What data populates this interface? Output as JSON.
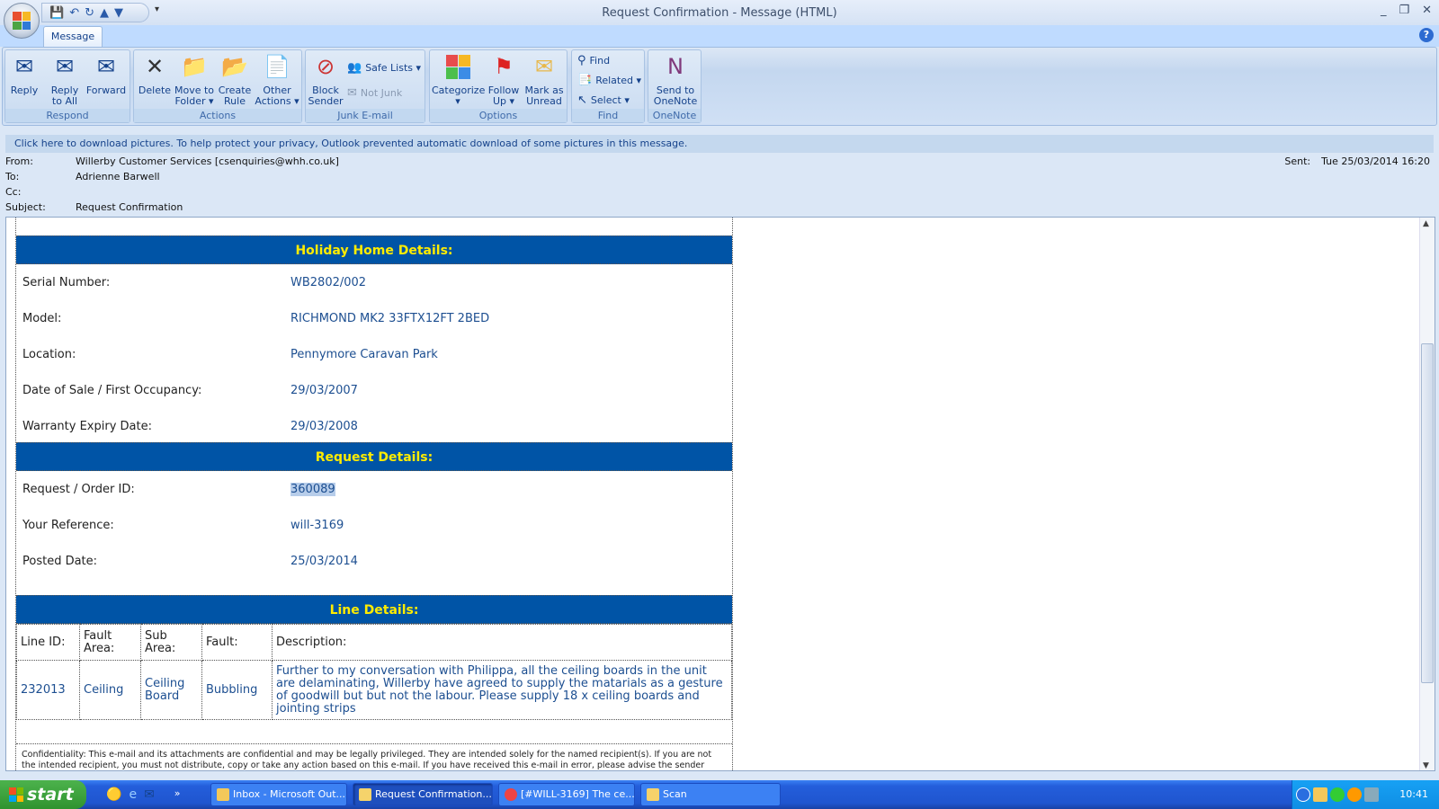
{
  "window": {
    "title": "Request Confirmation - Message (HTML)",
    "controls": [
      "_",
      "❐",
      "✕"
    ]
  },
  "quick_access": {
    "icons": [
      "save-icon",
      "undo-icon",
      "redo-icon",
      "previous-icon",
      "next-icon"
    ],
    "more": "▾"
  },
  "tabs": [
    {
      "label": "Message",
      "active": true
    }
  ],
  "ribbon": {
    "groups": [
      {
        "label": "Respond",
        "buttons": [
          "Reply",
          "Reply\nto All",
          "Forward"
        ]
      },
      {
        "label": "Actions",
        "buttons": [
          "Delete",
          "Move to\nFolder ▾",
          "Create\nRule",
          "Other\nActions ▾"
        ]
      },
      {
        "label": "Junk E-mail",
        "buttons": [
          "Block\nSender"
        ],
        "small": [
          "Safe Lists ▾",
          "Not Junk"
        ]
      },
      {
        "label": "Options",
        "buttons": [
          "Categorize\n▾",
          "Follow\nUp ▾",
          "Mark as\nUnread"
        ]
      },
      {
        "label": "Find",
        "small": [
          "Find",
          "Related ▾",
          "Select ▾"
        ]
      },
      {
        "label": "OneNote",
        "buttons": [
          "Send to\nOneNote"
        ]
      }
    ]
  },
  "infobar": "Click here to download pictures. To help protect your privacy, Outlook prevented automatic download of some pictures in this message.",
  "header": {
    "from_label": "From:",
    "from": "Willerby Customer Services [csenquiries@whh.co.uk]",
    "to_label": "To:",
    "to": "Adrienne Barwell",
    "cc_label": "Cc:",
    "cc": "",
    "subject_label": "Subject:",
    "subject": "Request Confirmation",
    "sent_label": "Sent:",
    "sent": "Tue 25/03/2014 16:20"
  },
  "email": {
    "holiday_title": "Holiday Home Details:",
    "holiday": [
      {
        "label": "Serial Number:",
        "value": "WB2802/002"
      },
      {
        "label": "Model:",
        "value": "RICHMOND MK2 33FTX12FT 2BED"
      },
      {
        "label": "Location:",
        "value": "Pennymore Caravan Park"
      },
      {
        "label": "Date of Sale / First Occupancy:",
        "value": "29/03/2007"
      },
      {
        "label": "Warranty Expiry Date:",
        "value": "29/03/2008"
      }
    ],
    "request_title": "Request Details:",
    "request": [
      {
        "label": "Request / Order ID:",
        "value": "360089",
        "selected": true
      },
      {
        "label": "Your Reference:",
        "value": "will-3169"
      },
      {
        "label": "Posted Date:",
        "value": "25/03/2014"
      }
    ],
    "line_title": "Line Details:",
    "line_headers": [
      "Line ID:",
      "Fault Area:",
      "Sub Area:",
      "Fault:",
      "Description:"
    ],
    "line_rows": [
      [
        "232013",
        "Ceiling",
        "Ceiling Board",
        "Bubbling",
        "Further to my conversation with Philippa, all the ceiling boards in the unit are delaminating, Willerby have agreed to supply the matarials as a gesture of goodwill but but not the labour. Please supply 18 x ceiling boards and jointing strips"
      ]
    ],
    "confidentiality": "Confidentiality: This e-mail and its attachments are confidential and may be legally privileged. They are intended solely for the named recipient(s). If you are not the intended recipient, you must not distribute, copy or take any action based on this e-mail. If you have received this e-mail in error, please advise the sender"
  },
  "taskbar": {
    "start": "start",
    "more": "»",
    "tasks": [
      {
        "label": "Inbox - Microsoft Out...",
        "active": false
      },
      {
        "label": "Request Confirmation...",
        "active": true
      },
      {
        "label": "[#WILL-3169] The ce...",
        "active": false
      },
      {
        "label": "Scan",
        "active": false
      }
    ],
    "clock": "10:41"
  }
}
